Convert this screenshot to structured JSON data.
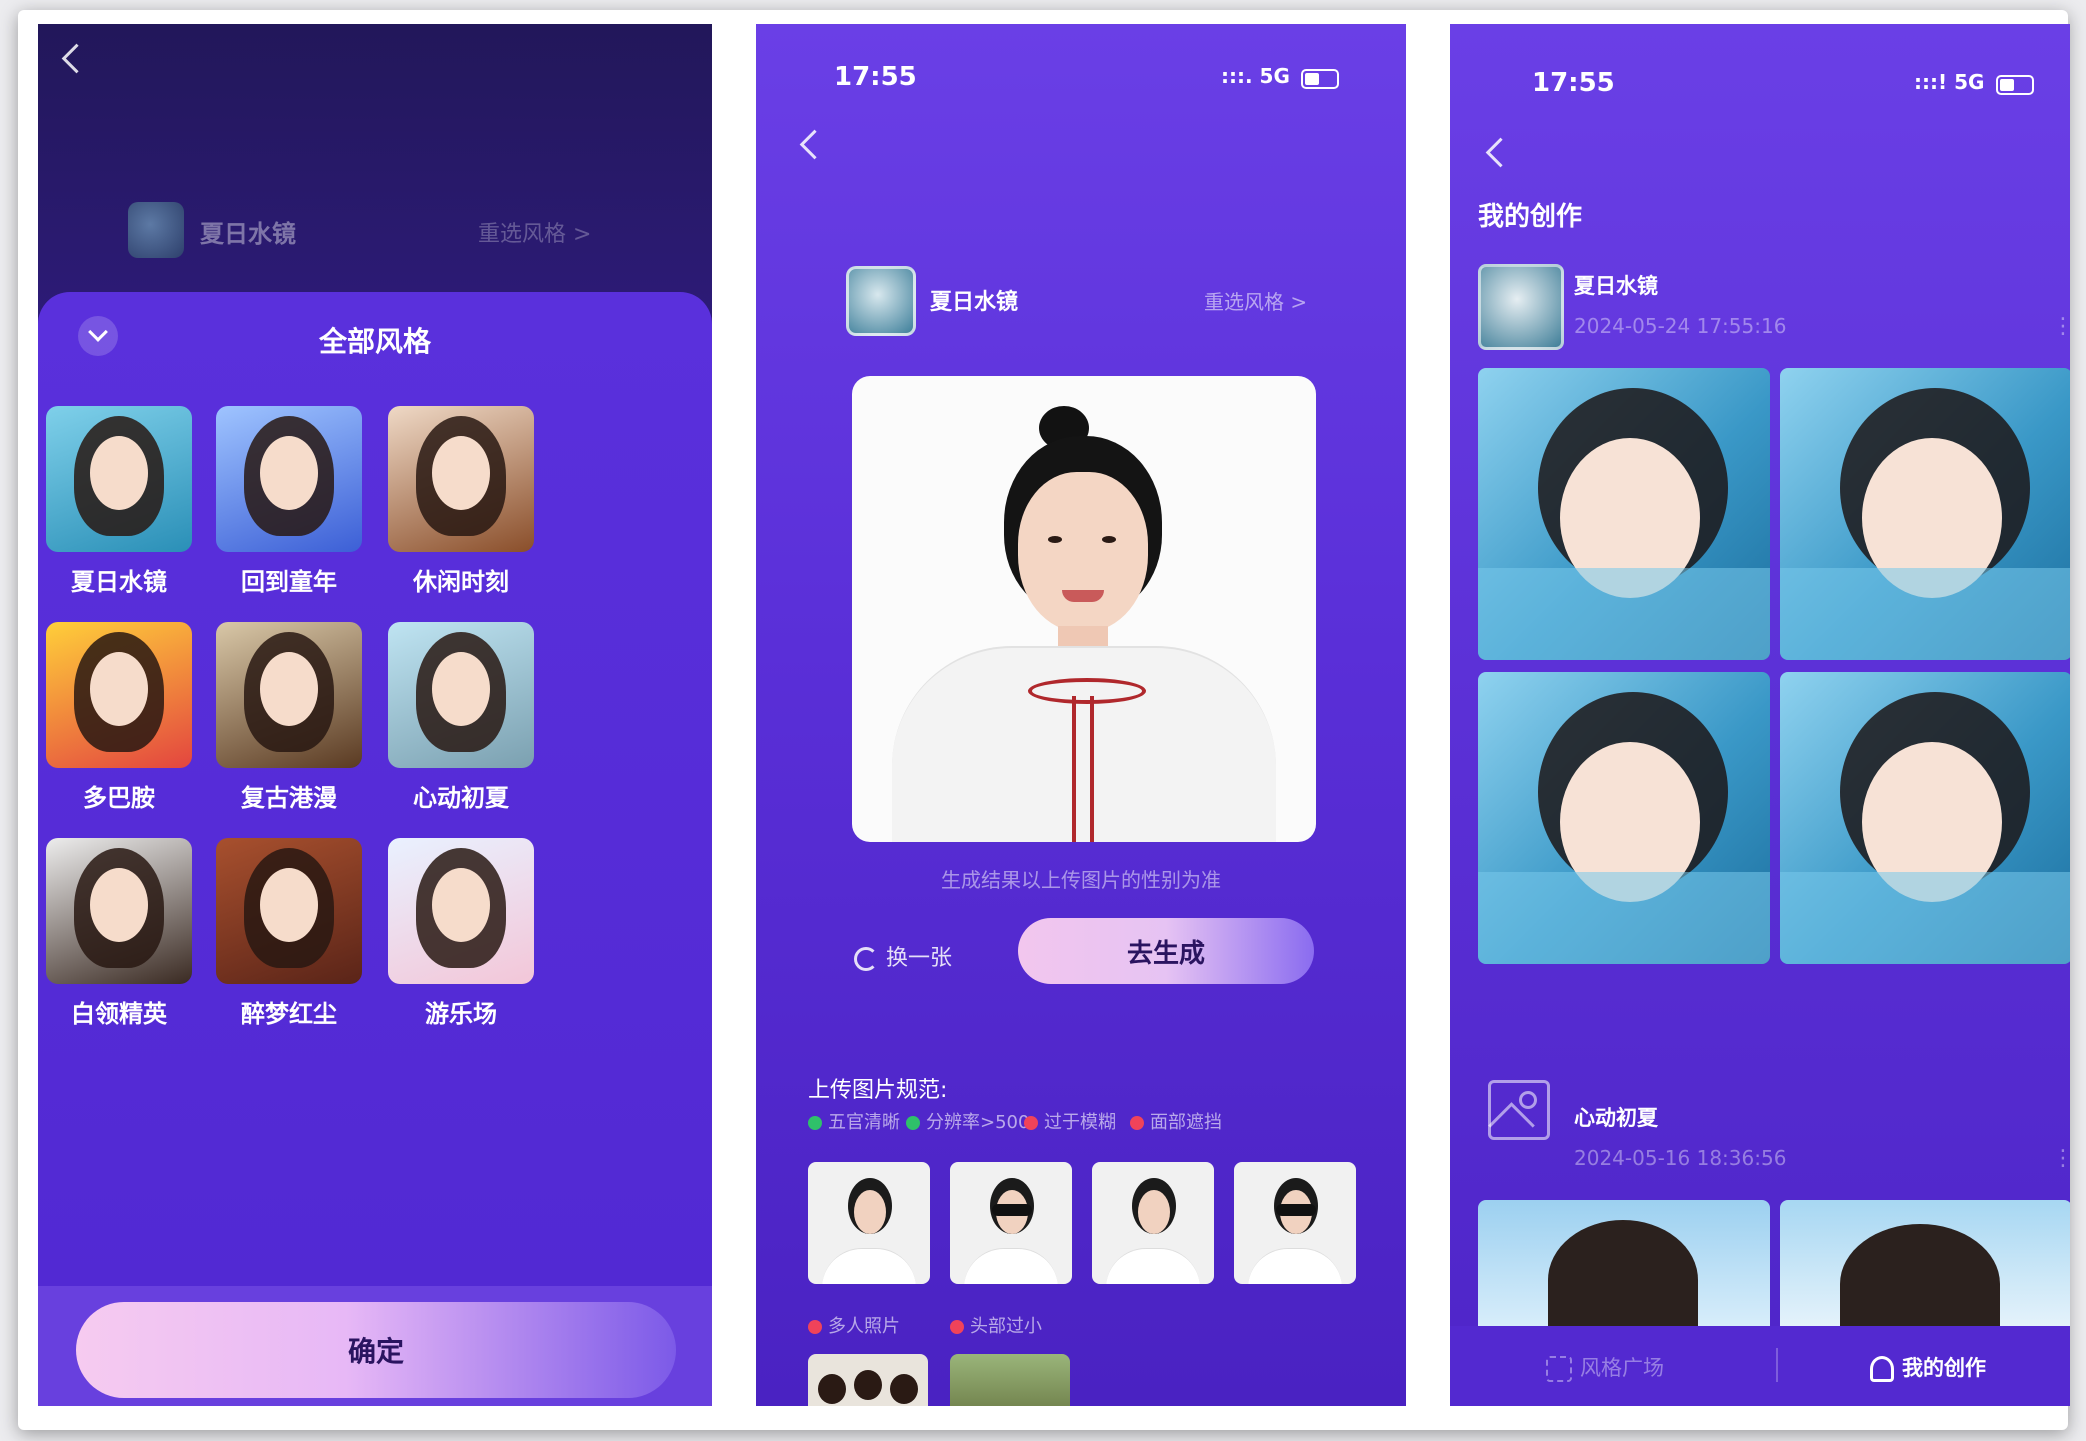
{
  "screen1": {
    "back_icon": "chevron-left-icon",
    "current_style": "夏日水镜",
    "reselect": "重选风格 >",
    "sheet_title": "全部风格",
    "collapse_icon": "chevron-down-icon",
    "styles": [
      {
        "label": "夏日水镜",
        "colors": [
          "#7fd0ea",
          "#2a8fb7"
        ]
      },
      {
        "label": "回到童年",
        "colors": [
          "#9fc4ff",
          "#3c5fd6"
        ]
      },
      {
        "label": "休闲时刻",
        "colors": [
          "#efd9c6",
          "#8a4e2a"
        ]
      },
      {
        "label": "多巴胺",
        "colors": [
          "#ffcf3a",
          "#e3453f"
        ]
      },
      {
        "label": "复古港漫",
        "colors": [
          "#d9c8a8",
          "#5a3a22"
        ]
      },
      {
        "label": "心动初夏",
        "colors": [
          "#bfe4f2",
          "#7ba0b0"
        ]
      },
      {
        "label": "白领精英",
        "colors": [
          "#ededed",
          "#3a2a22"
        ]
      },
      {
        "label": "醉梦红尘",
        "colors": [
          "#a8502e",
          "#5a2418"
        ]
      },
      {
        "label": "游乐场",
        "colors": [
          "#e9f1ff",
          "#f3c6d8"
        ]
      }
    ],
    "confirm": "确定"
  },
  "screen2": {
    "time": "17:55",
    "signal": ":::. 5G",
    "back_icon": "chevron-left-icon",
    "current_style": "夏日水镜",
    "reselect": "重选风格 >",
    "hint": "生成结果以上传图片的性别为准",
    "swap_icon": "refresh-icon",
    "swap": "换一张",
    "generate": "去生成",
    "spec_title": "上传图片规范:",
    "specs": [
      {
        "label": "五官清晰",
        "color": "#2fc16a"
      },
      {
        "label": "分辨率>500",
        "color": "#2fc16a"
      },
      {
        "label": "过于模糊",
        "color": "#f0435a"
      },
      {
        "label": "面部遮挡",
        "color": "#f0435a"
      }
    ],
    "specs2": [
      {
        "label": "多人照片",
        "color": "#f0435a"
      },
      {
        "label": "头部过小",
        "color": "#f0435a"
      }
    ]
  },
  "screen3": {
    "time": "17:55",
    "signal": ":::! 5G",
    "back_icon": "chevron-left-icon",
    "title": "我的创作",
    "item1": {
      "name": "夏日水镜",
      "date": "2024-05-24 17:55:16"
    },
    "item2": {
      "name": "心动初夏",
      "date": "2024-05-16 18:36:56"
    },
    "nav": [
      {
        "label": "风格广场",
        "icon": "grid-icon"
      },
      {
        "label": "我的创作",
        "icon": "user-icon"
      }
    ]
  }
}
